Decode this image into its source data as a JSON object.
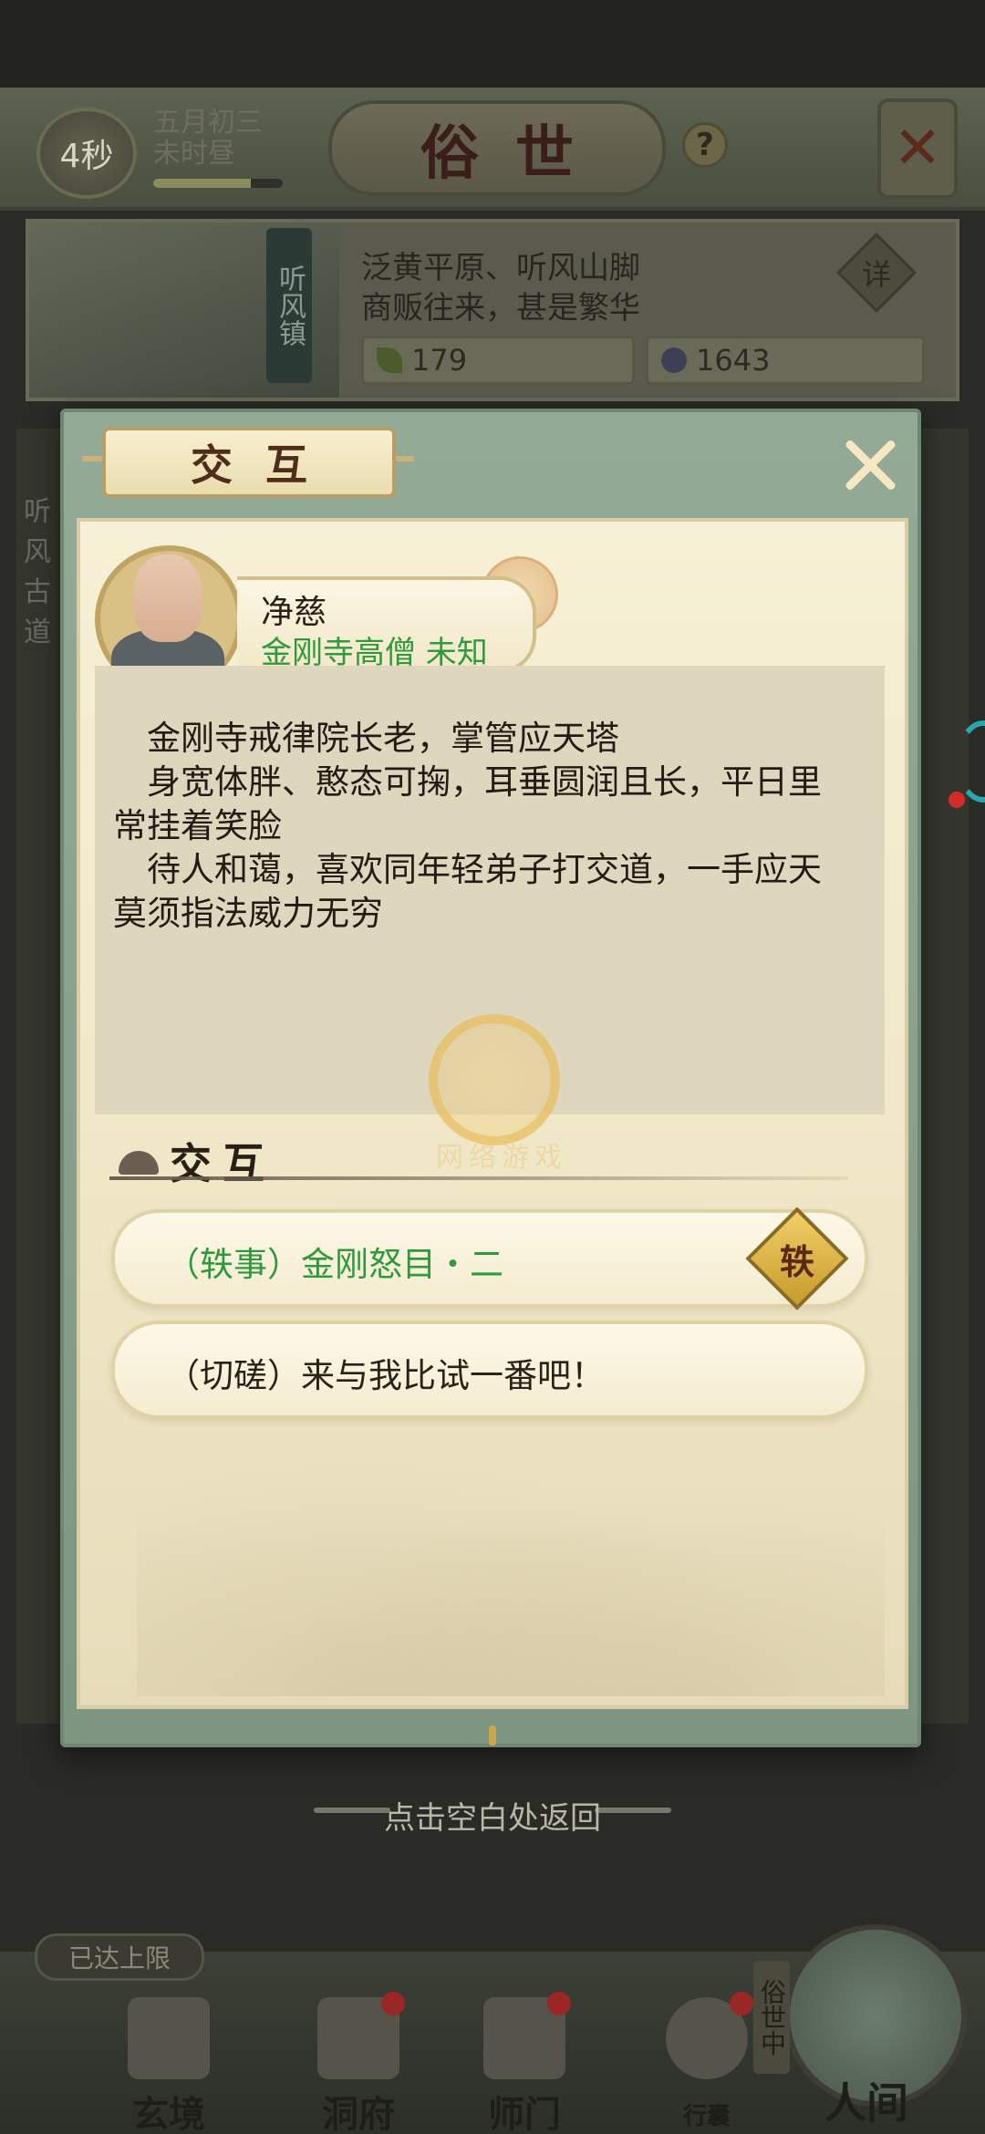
{
  "header": {
    "timer": "4秒",
    "date_line1": "五月初三",
    "date_line2": "未时昼",
    "time_progress": 0.75,
    "title": "俗世",
    "help_label": "?"
  },
  "town": {
    "sign": "听风镇",
    "desc_line1": "泛黄平原、听风山脚",
    "desc_line2": "商贩往来，甚是繁华",
    "detail_label": "详",
    "resource_leaf": "179",
    "resource_coin": "1643"
  },
  "side": {
    "left_text": "听风古道"
  },
  "modal": {
    "tab_title": "交互",
    "npc": {
      "name": "净慈",
      "subtitle": "金刚寺高僧 未知"
    },
    "description": [
      "　金刚寺戒律院长老，掌管应天塔",
      "　身宽体胖、憨态可掬，耳垂圆润且长，平日里",
      "常挂着笑脸",
      "　待人和蔼，喜欢同年轻弟子打交道，一手应天",
      "莫须指法威力无穷"
    ],
    "watermark_text": "网络游戏",
    "section_title": "交互",
    "options": [
      {
        "label": "（轶事）金刚怒目・二",
        "color": "#2f9a3d",
        "badge": "轶"
      },
      {
        "label": "（切磋）来与我比试一番吧！",
        "color": "#2a2118"
      }
    ]
  },
  "dismiss_hint": "点击空白处返回",
  "bottom_nav": {
    "limit_badge": "已达上限",
    "items": [
      {
        "label": "玄境",
        "icon": "scroll-icon",
        "dot": false
      },
      {
        "label": "洞府",
        "icon": "pavilion-icon",
        "dot": true
      },
      {
        "label": "师门",
        "icon": "banner-icon",
        "dot": true
      },
      {
        "label": "行囊",
        "icon": "bag-icon",
        "dot": true
      }
    ],
    "world_sign": "俗世中",
    "world_label": "人间"
  }
}
